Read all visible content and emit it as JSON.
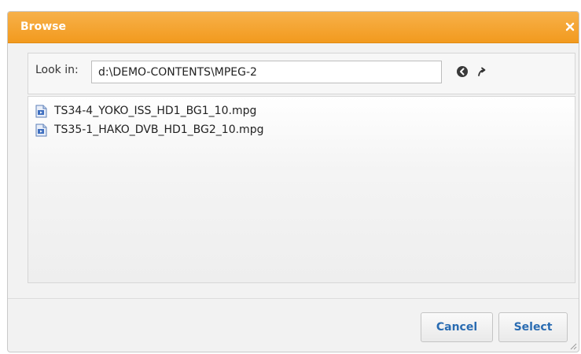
{
  "dialog": {
    "title": "Browse",
    "close_icon": "close-icon"
  },
  "lookin": {
    "label": "Look in:",
    "value": "d:\\DEMO-CONTENTS\\MPEG-2",
    "back_icon": "back-circle-icon",
    "up_icon": "up-folder-arrow-icon"
  },
  "files": [
    {
      "name": "TS34-4_YOKO_ISS_HD1_BG1_10.mpg",
      "icon": "video-file-icon"
    },
    {
      "name": "TS35-1_HAKO_DVB_HD1_BG2_10.mpg",
      "icon": "video-file-icon"
    }
  ],
  "buttons": {
    "cancel": "Cancel",
    "select": "Select"
  },
  "colors": {
    "titlebar": "#f29a1e",
    "button_text": "#2a6cb2"
  }
}
